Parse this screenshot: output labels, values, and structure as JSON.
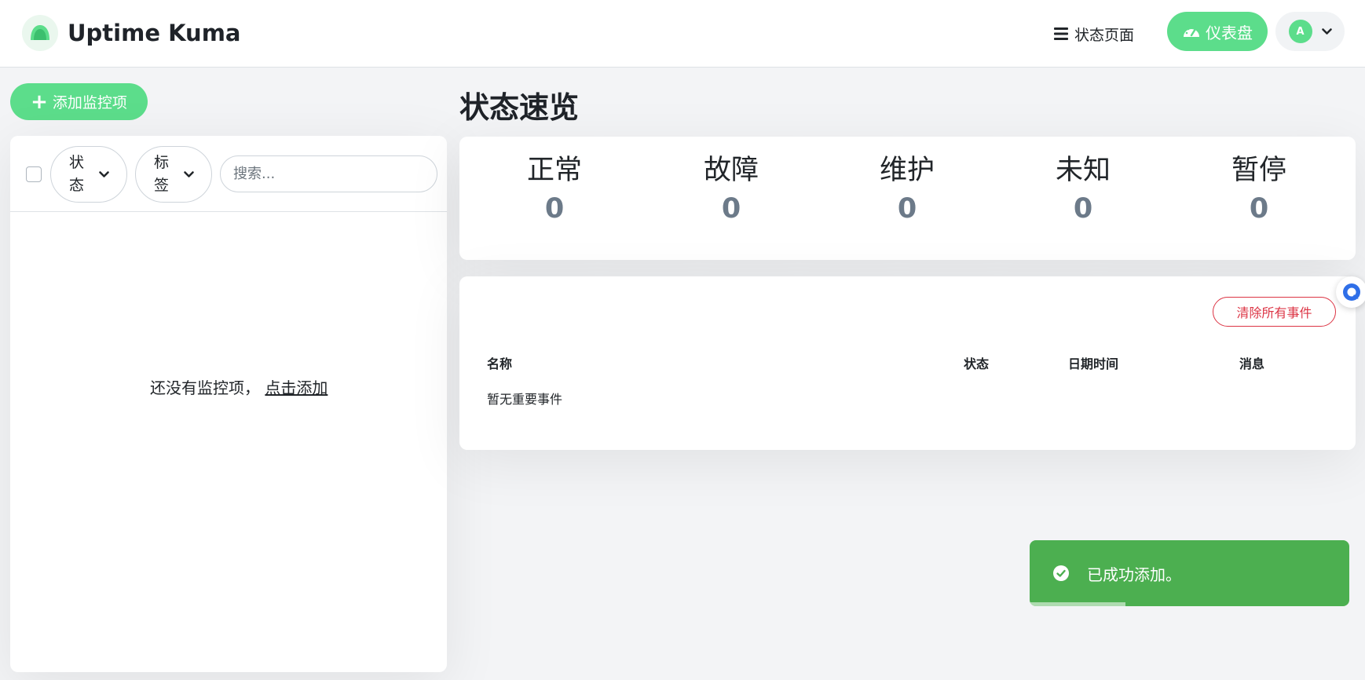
{
  "app": {
    "title": "Uptime Kuma"
  },
  "nav": {
    "status_page": "状态页面",
    "dashboard": "仪表盘",
    "avatar_letter": "A"
  },
  "sidebar": {
    "add_button": "添加监控项",
    "filter_status": "状态",
    "filter_tags": "标签",
    "search_placeholder": "搜索...",
    "empty_text": "还没有监控项，",
    "empty_link": "点击添加"
  },
  "overview": {
    "title": "状态速览",
    "stats": [
      {
        "label": "正常",
        "value": "0"
      },
      {
        "label": "故障",
        "value": "0"
      },
      {
        "label": "维护",
        "value": "0"
      },
      {
        "label": "未知",
        "value": "0"
      },
      {
        "label": "暂停",
        "value": "0"
      }
    ]
  },
  "events": {
    "clear_button": "清除所有事件",
    "columns": [
      "名称",
      "状态",
      "日期时间",
      "消息"
    ],
    "empty": "暂无重要事件"
  },
  "toast": {
    "message": "已成功添加。",
    "progress": 0.3
  },
  "colors": {
    "accent": "#5cdd8b",
    "danger": "#dc3545",
    "success": "#4caf50",
    "stat_number": "#6c7a89"
  }
}
